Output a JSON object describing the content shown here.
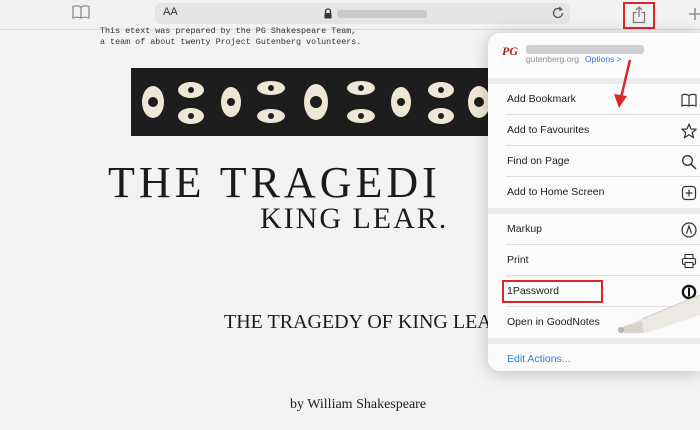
{
  "toolbar": {
    "reader_text_size_label": "AA",
    "icons": [
      "bookmarks-icon",
      "lock-icon",
      "reload-icon",
      "share-icon",
      "new-tab-icon"
    ],
    "highlight_color": "#e0242c"
  },
  "page": {
    "etext_line1": "This etext was prepared by the PG Shakespeare Team,",
    "etext_line2": "a team of about twenty Project Gutenberg volunteers.",
    "title_main": "THE TRAGEDI",
    "title_sub": "KING LEAR.",
    "html_title": "THE TRAGEDY OF KING LEA",
    "byline": "by William Shakespeare"
  },
  "share_menu": {
    "site_icon_text": "PG",
    "domain": "gutenberg.org",
    "options_label": "Options >",
    "group1": [
      {
        "label": "Add Bookmark",
        "icon": "book-icon"
      },
      {
        "label": "Add to Favourites",
        "icon": "star-icon"
      },
      {
        "label": "Find on Page",
        "icon": "magnifier-icon"
      },
      {
        "label": "Add to Home Screen",
        "icon": "plus-square-icon"
      }
    ],
    "group2": [
      {
        "label": "Markup",
        "icon": "markup-icon"
      },
      {
        "label": "Print",
        "icon": "printer-icon"
      },
      {
        "label": "1Password",
        "icon": "onepassword-icon"
      },
      {
        "label": "Open in GoodNotes",
        "icon": ""
      }
    ],
    "edit_actions_label": "Edit Actions...",
    "accent_color": "#2c7de0"
  }
}
